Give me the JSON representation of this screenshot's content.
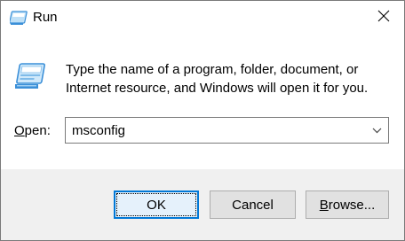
{
  "window": {
    "title": "Run",
    "close_glyph": "✕"
  },
  "icons": {
    "title": "run-icon",
    "main": "run-icon",
    "close": "close-icon",
    "dropdown": "chevron-down-icon"
  },
  "prompt": {
    "description": "Type the name of a program, folder, document, or Internet resource, and Windows will open it for you."
  },
  "open_field": {
    "label_underlined": "O",
    "label_rest": "pen:",
    "value": "msconfig"
  },
  "buttons": {
    "ok": "OK",
    "cancel": "Cancel",
    "browse_underlined": "B",
    "browse_rest": "rowse..."
  },
  "colors": {
    "accent": "#0078d7",
    "footer_bg": "#f0f0f0",
    "button_bg": "#e1e1e1",
    "icon_blue": "#3a8fd8"
  }
}
